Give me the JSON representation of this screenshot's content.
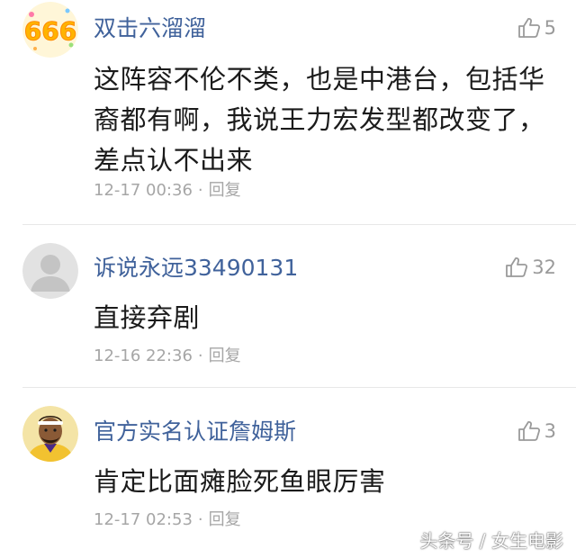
{
  "comments": [
    {
      "avatar_icon": "666-sticker-avatar-icon",
      "username": "双击六溜溜",
      "likes": "5",
      "lines": [
        "这阵容不伦不类，也是中港台，包括华",
        "裔都有啊，我说王力宏发型都改变了，",
        "差点认不出来"
      ],
      "time": "12-17 00:36",
      "separator": "·",
      "reply": "回复"
    },
    {
      "avatar_icon": "default-gray-avatar-icon",
      "username": "诉说永远33490131",
      "likes": "32",
      "lines": [
        "直接弃剧"
      ],
      "time": "12-16 22:36",
      "separator": "·",
      "reply": "回复"
    },
    {
      "avatar_icon": "player-cartoon-avatar-icon",
      "username": "官方实名认证詹姆斯",
      "likes": "3",
      "lines": [
        "肯定比面瘫脸死鱼眼厉害"
      ],
      "time": "12-17 02:53",
      "separator": "·",
      "reply": "回复"
    }
  ],
  "watermark": "头条号 / 女生电影",
  "colors": {
    "username": "#40629b",
    "body_text": "#1b1b1b",
    "meta": "#a6a6a6",
    "divider": "#e8e8e8"
  }
}
